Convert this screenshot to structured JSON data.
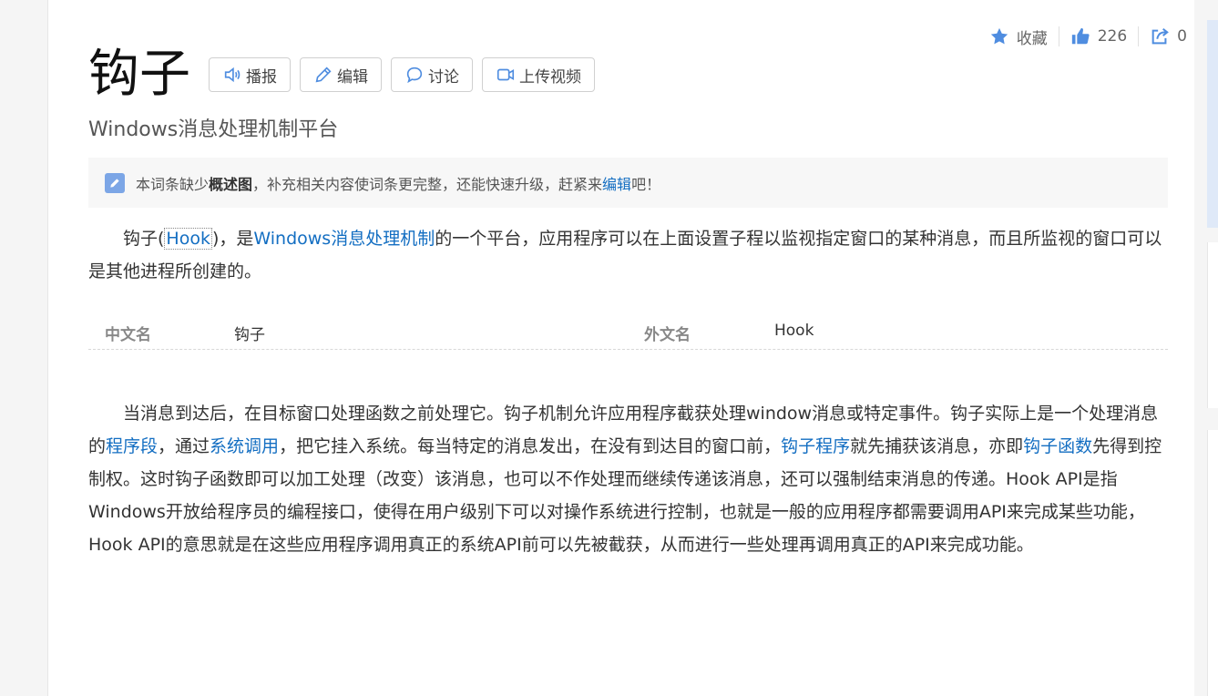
{
  "actions": {
    "favorite_label": "收藏",
    "like_count": "226",
    "share_count": "0"
  },
  "title": "钩子",
  "toolbar": {
    "broadcast_label": "播报",
    "edit_label": "编辑",
    "discuss_label": "讨论",
    "upload_video_label": "上传视频"
  },
  "subtitle": "Windows消息处理机制平台",
  "notice": {
    "prefix": "本词条缺少",
    "bold": "概述图",
    "middle": "，补充相关内容使词条更完整，还能快速升级，赶紧来",
    "link": "编辑",
    "suffix": "吧！"
  },
  "intro": {
    "p1": "钩子(",
    "hook": "Hook",
    "p2": ")，是",
    "link1": "Windows消息处理机制",
    "p3": "的一个平台，应用程序可以在上面设置子程以监视指定窗口的某种消息，而且所监视的窗口可以是其他进程所创建的。"
  },
  "infobox": {
    "label1": "中文名",
    "value1": "钩子",
    "label2": "外文名",
    "value2": "Hook"
  },
  "body": {
    "t1": "当消息到达后，在目标窗口处理函数之前处理它。钩子机制允许应用程序截获处理window消息或特定事件。钩子实际上是一个处理消息的",
    "l1": "程序段",
    "t2": "，通过",
    "l2": "系统调用",
    "t3": "，把它挂入系统。每当特定的消息发出，在没有到达目的窗口前，",
    "l3": "钩子程序",
    "t4": "就先捕获该消息，亦即",
    "l4": "钩子函数",
    "t5": "先得到控制权。这时钩子函数即可以加工处理（改变）该消息，也可以不作处理而继续传递该消息，还可以强制结束消息的传递。Hook API是指Windows开放给程序员的编程接口，使得在用户级别下可以对操作系统进行控制，也就是一般的应用程序都需要调用API来完成某些功能，Hook API的意思就是在这些应用程序调用真正的系统API前可以先被截获，从而进行一些处理再调用真正的API来完成功能。"
  },
  "colors": {
    "link": "#136ec2",
    "icon_blue": "#4f8de0"
  }
}
